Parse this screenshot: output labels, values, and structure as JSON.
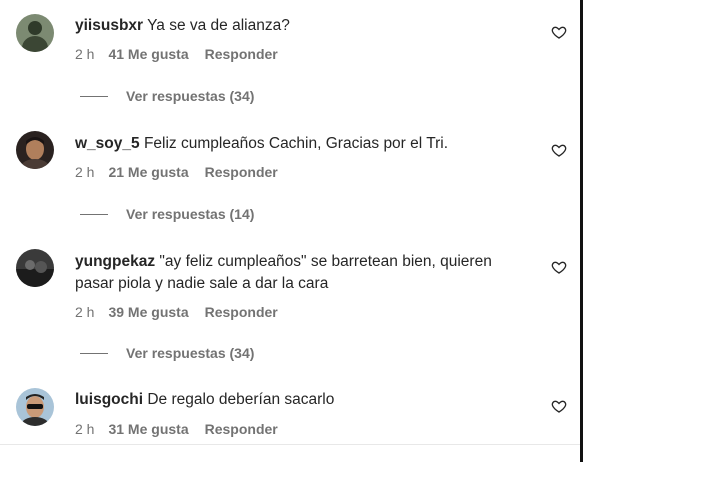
{
  "comments": [
    {
      "username": "yiisusbxr",
      "text": "Ya se va de alianza?",
      "time": "2 h",
      "likes": "41 Me gusta",
      "reply": "Responder",
      "replies": "Ver respuestas (34)",
      "avatar_icon": "avatar-dark-figure"
    },
    {
      "username": "w_soy_5",
      "text": "Feliz cumpleaños Cachin, Gracias por el Tri.",
      "time": "2 h",
      "likes": "21 Me gusta",
      "reply": "Responder",
      "replies": "Ver respuestas (14)",
      "avatar_icon": "avatar-face"
    },
    {
      "username": "yungpekaz",
      "text": "\"ay feliz cumpleaños\" se barretean bien, quieren pasar piola y nadie sale a dar la cara",
      "time": "2 h",
      "likes": "39 Me gusta",
      "reply": "Responder",
      "replies": "Ver respuestas (34)",
      "avatar_icon": "avatar-dark-scene"
    },
    {
      "username": "luisgochi",
      "text": "De regalo deberían sacarlo",
      "time": "2 h",
      "likes": "31 Me gusta",
      "reply": "Responder",
      "avatar_icon": "avatar-sunglasses"
    }
  ],
  "icons": {
    "like": "heart-outline-icon"
  },
  "colors": {
    "text": "#262626",
    "secondary": "#737373",
    "background": "#ffffff"
  }
}
